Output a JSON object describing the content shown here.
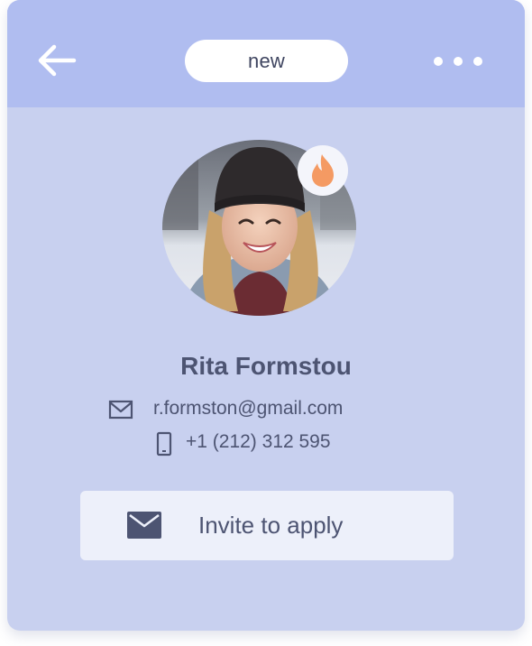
{
  "header": {
    "status_label": "new",
    "back_icon": "arrow-left-icon",
    "more_icon": "more-horizontal-icon"
  },
  "profile": {
    "name": "Rita Formstou",
    "email": "r.formston@gmail.com",
    "phone": "+1 (212) 312 595",
    "badge_icon": "fire-icon"
  },
  "action": {
    "label": "Invite to apply",
    "icon": "envelope-icon"
  },
  "colors": {
    "card_background": "#c8d0ef",
    "header_background": "#b0bdf0",
    "badge_flame": "#f49a63",
    "text": "#4d5472",
    "button_background": "#edf0fa"
  }
}
